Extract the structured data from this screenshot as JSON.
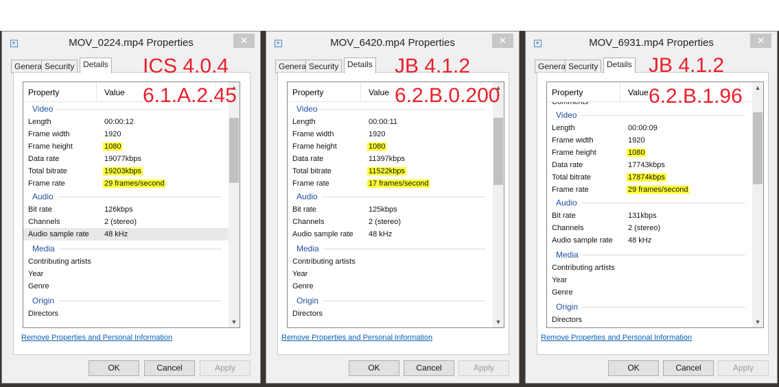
{
  "dialogs": [
    {
      "title": "MOV_0224.mp4 Properties",
      "tabs": [
        "General",
        "Security",
        "Details"
      ],
      "active_tab": "Details",
      "headers": [
        "Property",
        "Value"
      ],
      "annotation": [
        "ICS 4.0.4",
        "6.1.A.2.45"
      ],
      "items": [
        {
          "group": "Video"
        },
        {
          "p": "Length",
          "v": "00:00:12"
        },
        {
          "p": "Frame width",
          "v": "1920"
        },
        {
          "p": "Frame height",
          "v": "1080",
          "highlight": true
        },
        {
          "p": "Data rate",
          "v": "19077kbps"
        },
        {
          "p": "Total bitrate",
          "v": "19203kbps",
          "highlight": true
        },
        {
          "p": "Frame rate",
          "v": "29 frames/second",
          "highlight": true
        },
        {
          "group": "Audio"
        },
        {
          "p": "Bit rate",
          "v": "126kbps"
        },
        {
          "p": "Channels",
          "v": "2 (stereo)"
        },
        {
          "p": "Audio sample rate",
          "v": "48 kHz",
          "selected": true
        },
        {
          "group": "Media"
        },
        {
          "p": "Contributing artists",
          "v": ""
        },
        {
          "p": "Year",
          "v": ""
        },
        {
          "p": "Genre",
          "v": ""
        },
        {
          "group": "Origin"
        },
        {
          "p": "Directors",
          "v": ""
        }
      ],
      "link": "Remove Properties and Personal Information",
      "buttons": {
        "ok": "OK",
        "cancel": "Cancel",
        "apply": "Apply"
      }
    },
    {
      "title": "MOV_6420.mp4 Properties",
      "tabs": [
        "General",
        "Security",
        "Details"
      ],
      "active_tab": "Details",
      "headers": [
        "Property",
        "Value"
      ],
      "annotation": [
        "JB 4.1.2",
        "6.2.B.0.200"
      ],
      "items": [
        {
          "group": "Video"
        },
        {
          "p": "Length",
          "v": "00:00:11"
        },
        {
          "p": "Frame width",
          "v": "1920"
        },
        {
          "p": "Frame height",
          "v": "1080",
          "highlight": true
        },
        {
          "p": "Data rate",
          "v": "11397kbps"
        },
        {
          "p": "Total bitrate",
          "v": "11522kbps",
          "highlight": true
        },
        {
          "p": "Frame rate",
          "v": "17 frames/second",
          "highlight": true
        },
        {
          "group": "Audio"
        },
        {
          "p": "Bit rate",
          "v": "125kbps"
        },
        {
          "p": "Channels",
          "v": "2 (stereo)"
        },
        {
          "p": "Audio sample rate",
          "v": "48 kHz"
        },
        {
          "group": "Media"
        },
        {
          "p": "Contributing artists",
          "v": ""
        },
        {
          "p": "Year",
          "v": ""
        },
        {
          "p": "Genre",
          "v": ""
        },
        {
          "group": "Origin"
        },
        {
          "p": "Directors",
          "v": ""
        }
      ],
      "link": "Remove Properties and Personal Information",
      "buttons": {
        "ok": "OK",
        "cancel": "Cancel",
        "apply": "Apply"
      }
    },
    {
      "title": "MOV_6931.mp4 Properties",
      "tabs": [
        "General",
        "Security",
        "Details"
      ],
      "active_tab": "Details",
      "headers": [
        "Property",
        "Value"
      ],
      "annotation": [
        "JB 4.1.2",
        "6.2.B.1.96"
      ],
      "items": [
        {
          "p": "Comments",
          "v": ""
        },
        {
          "group": "Video"
        },
        {
          "p": "Length",
          "v": "00:00:09"
        },
        {
          "p": "Frame width",
          "v": "1920"
        },
        {
          "p": "Frame height",
          "v": "1080",
          "highlight": true
        },
        {
          "p": "Data rate",
          "v": "17743kbps"
        },
        {
          "p": "Total bitrate",
          "v": "17874kbps",
          "highlight": true
        },
        {
          "p": "Frame rate",
          "v": "29 frames/second",
          "highlight": true
        },
        {
          "group": "Audio"
        },
        {
          "p": "Bit rate",
          "v": "131kbps"
        },
        {
          "p": "Channels",
          "v": "2 (stereo)"
        },
        {
          "p": "Audio sample rate",
          "v": "48 kHz"
        },
        {
          "group": "Media"
        },
        {
          "p": "Contributing artists",
          "v": ""
        },
        {
          "p": "Year",
          "v": ""
        },
        {
          "p": "Genre",
          "v": ""
        },
        {
          "group": "Origin"
        },
        {
          "p": "Directors",
          "v": ""
        }
      ],
      "link": "Remove Properties and Personal Information",
      "buttons": {
        "ok": "OK",
        "cancel": "Cancel",
        "apply": "Apply"
      }
    }
  ],
  "colors": {
    "annotation": "#e8202a",
    "highlight": "#ffff33",
    "link": "#0a5fb4",
    "group_heading": "#1e4e9e"
  },
  "icons": {
    "close": "close-icon",
    "app": "video-file-icon",
    "scroll_up": "chevron-up-icon",
    "scroll_down": "chevron-down-icon"
  }
}
